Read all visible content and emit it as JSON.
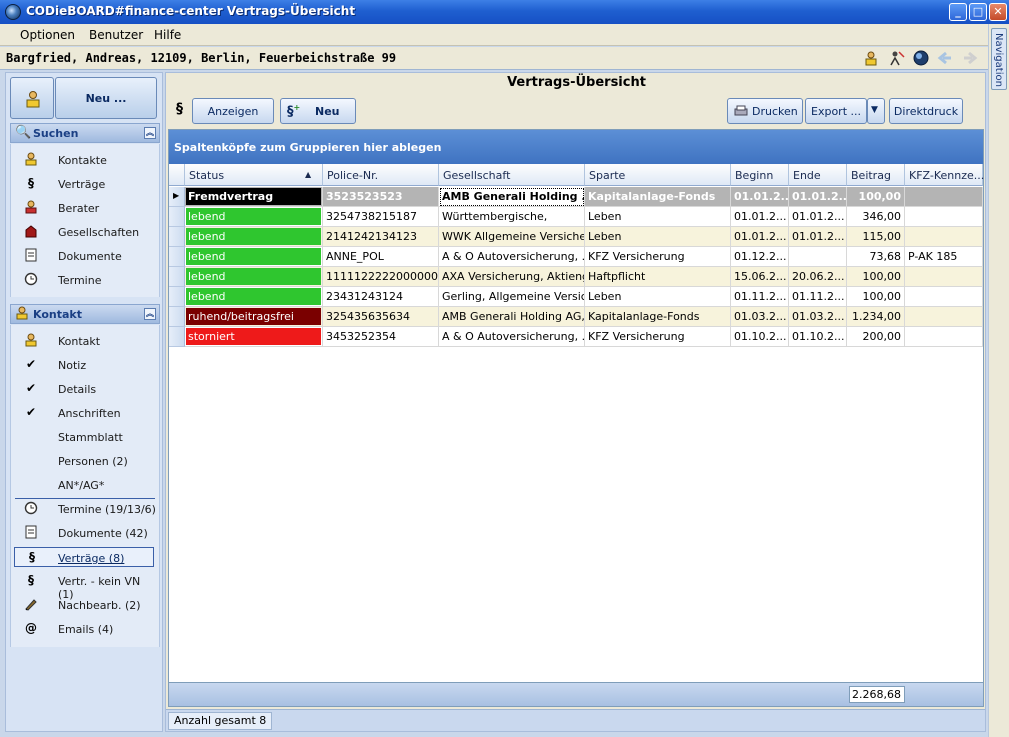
{
  "window": {
    "title": "CODieBOARD#finance-center Vertrags-Übersicht",
    "controls": {
      "minimize": "_",
      "maximize": "□",
      "close": "✕"
    }
  },
  "menu": {
    "items": [
      "Optionen",
      "Benutzer",
      "Hilfe"
    ]
  },
  "address": "Bargfried, Andreas, 12109, Berlin, Feuerbeichstraße 99",
  "navigation_tab": "Navigation",
  "left": {
    "new_button": "Neu ...",
    "search_group": {
      "title": "Suchen",
      "items": [
        {
          "label": "Kontakte",
          "icon": "contact-icon"
        },
        {
          "label": "Verträge",
          "icon": "paragraph-icon"
        },
        {
          "label": "Berater",
          "icon": "advisor-icon"
        },
        {
          "label": "Gesellschaften",
          "icon": "company-icon"
        },
        {
          "label": "Dokumente",
          "icon": "document-icon"
        },
        {
          "label": "Termine",
          "icon": "clock-icon"
        }
      ]
    },
    "contact_group": {
      "title": "Kontakt",
      "items": [
        {
          "label": "Kontakt",
          "icon": "contact-icon"
        },
        {
          "label": "Notiz",
          "icon": "check-icon"
        },
        {
          "label": "Details",
          "icon": "check-icon"
        },
        {
          "label": "Anschriften",
          "icon": "check-icon"
        },
        {
          "label": "Stammblatt",
          "icon": ""
        },
        {
          "label": "Personen (2)",
          "icon": ""
        },
        {
          "label": "AN*/AG*",
          "icon": ""
        }
      ],
      "items2": [
        {
          "label": "Termine (19/13/6)",
          "icon": "clock-icon"
        },
        {
          "label": "Dokumente (42)",
          "icon": "document-icon"
        },
        {
          "label": "Verträge (8)",
          "icon": "paragraph-icon",
          "selected": true
        },
        {
          "label": "Vertr. - kein VN (1)",
          "icon": "paragraph-icon"
        },
        {
          "label": "Nachbearb. (2)",
          "icon": "pen-icon"
        },
        {
          "label": "Emails (4)",
          "icon": "email-icon"
        }
      ]
    }
  },
  "main": {
    "title": "Vertrags-Übersicht",
    "section_symbol": "§",
    "toolbar": {
      "show": "Anzeigen",
      "new": "Neu",
      "print": "Drucken",
      "export": "Export ...",
      "direct_print": "Direktdruck"
    },
    "group_hint": "Spaltenköpfe zum Gruppieren hier ablegen",
    "columns": [
      "Status",
      "Police-Nr.",
      "Gesellschaft",
      "Sparte",
      "Beginn",
      "Ende",
      "Beitrag",
      "KFZ-Kennze..."
    ],
    "rows": [
      {
        "status": "Fremdvertrag",
        "status_color": "#000000",
        "police": "3523523523",
        "gesellschaft": "AMB Generali Holding ...",
        "sparte": "Kapitalanlage-Fonds",
        "beginn": "01.01.2...",
        "ende": "01.01.2...",
        "beitrag": "100,00",
        "kfz": "",
        "selected": true
      },
      {
        "status": "lebend",
        "status_color": "#2fc62f",
        "police": "3254738215187",
        "gesellschaft": "Württembergische,",
        "sparte": "Leben",
        "beginn": "01.01.2...",
        "ende": "01.01.2...",
        "beitrag": "346,00",
        "kfz": ""
      },
      {
        "status": "lebend",
        "status_color": "#2fc62f",
        "police": "2141242134123",
        "gesellschaft": "WWK Allgemeine Versicher...",
        "sparte": "Leben",
        "beginn": "01.01.2...",
        "ende": "01.01.2...",
        "beitrag": "115,00",
        "kfz": ""
      },
      {
        "status": "lebend",
        "status_color": "#2fc62f",
        "police": "ANNE_POL",
        "gesellschaft": "A & O Autoversicherung, ...",
        "sparte": "KFZ Versicherung",
        "beginn": "01.12.2...",
        "ende": "",
        "beitrag": "73,68",
        "kfz": "P-AK 185"
      },
      {
        "status": "lebend",
        "status_color": "#2fc62f",
        "police": "1111122222000000",
        "gesellschaft": "AXA Versicherung, Aktieng...",
        "sparte": "Haftpflicht",
        "beginn": "15.06.2...",
        "ende": "20.06.2...",
        "beitrag": "100,00",
        "kfz": ""
      },
      {
        "status": "lebend",
        "status_color": "#2fc62f",
        "police": "23431243124",
        "gesellschaft": "Gerling, Allgemeine Versich...",
        "sparte": "Leben",
        "beginn": "01.11.2...",
        "ende": "01.11.2...",
        "beitrag": "100,00",
        "kfz": ""
      },
      {
        "status": "ruhend/beitragsfrei",
        "status_color": "#7a0000",
        "police": "325435635634",
        "gesellschaft": "AMB Generali Holding AG,",
        "sparte": "Kapitalanlage-Fonds",
        "beginn": "01.03.2...",
        "ende": "01.03.2...",
        "beitrag": "1.234,00",
        "kfz": ""
      },
      {
        "status": "storniert",
        "status_color": "#ee1a1a",
        "police": "3453252354",
        "gesellschaft": "A & O Autoversicherung, ...",
        "sparte": "KFZ Versicherung",
        "beginn": "01.10.2...",
        "ende": "01.10.2...",
        "beitrag": "200,00",
        "kfz": ""
      }
    ],
    "total": "2.268,68",
    "count": "Anzahl gesamt 8"
  }
}
